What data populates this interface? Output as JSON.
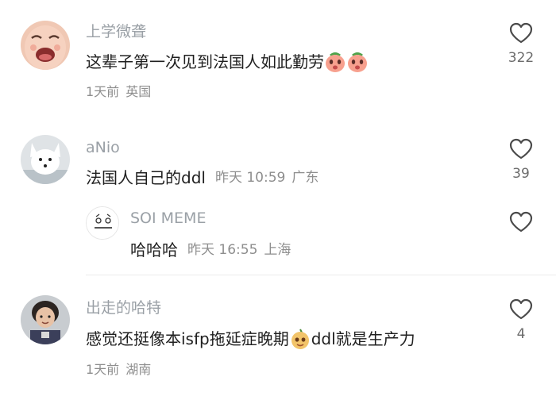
{
  "comments": [
    {
      "username": "上学微聋",
      "text": "这辈子第一次见到法国人如此勤劳",
      "date": "1天前",
      "location": "英国",
      "likes": "322",
      "avatar_icon": "crying-baby-avatar",
      "emoji_icons": [
        "peach-emoji",
        "peach-emoji"
      ]
    },
    {
      "username": "aNio",
      "text": "法国人自己的ddl",
      "date": "昨天 10:59",
      "location": "广东",
      "likes": "39",
      "avatar_icon": "white-fox-avatar",
      "replies": [
        {
          "username": "SOI MEME",
          "text": "哈哈哈",
          "date": "昨天 16:55",
          "location": "上海",
          "likes": "",
          "avatar_icon": "soi-meme-logo-avatar"
        }
      ]
    },
    {
      "username": "出走的哈特",
      "text_before_emoji": "感觉还挺像本isfp拖延症晚期",
      "text_after_emoji": "ddl就是生产力",
      "date": "1天前",
      "location": "湖南",
      "likes": "4",
      "avatar_icon": "child-photo-avatar",
      "emoji_icons": [
        "pear-face-emoji"
      ]
    }
  ],
  "icons": {
    "like": "heart-outline-icon"
  },
  "colors": {
    "username": "#9aa0a6",
    "text": "#1f1f1f",
    "meta": "#8e8e8e",
    "like_count": "#6b6b6b"
  }
}
